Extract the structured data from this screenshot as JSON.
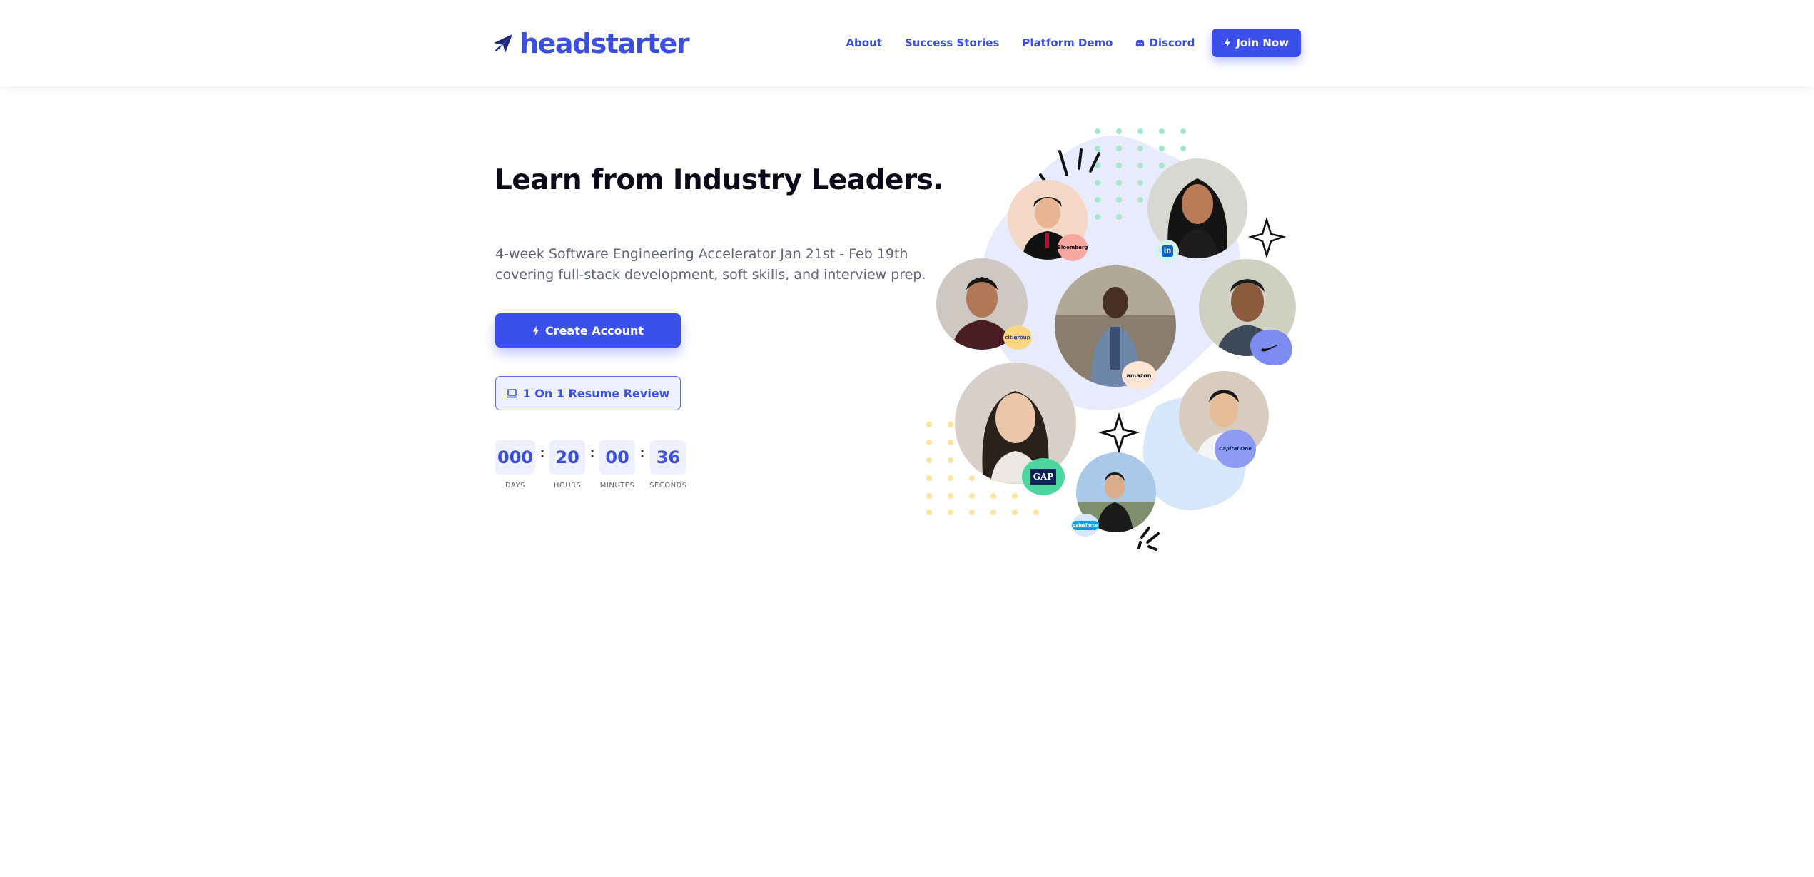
{
  "brand": {
    "name": "headstarter",
    "accent": "#3b4fea"
  },
  "nav": {
    "links": [
      {
        "label": "About"
      },
      {
        "label": "Success Stories"
      },
      {
        "label": "Platform Demo"
      },
      {
        "label": "Discord",
        "icon": "discord-icon"
      }
    ],
    "join_label": "Join Now"
  },
  "hero": {
    "title": "Learn from Industry Leaders.",
    "subtitle": "4-week Software Engineering Accelerator Jan 21st - Feb 19th covering full-stack development, soft skills, and interview prep.",
    "primary_button": "Create Account",
    "secondary_button": "1 On 1 Resume Review"
  },
  "countdown": {
    "days": "000",
    "days_label": "DAYS",
    "hours": "20",
    "hours_label": "HOURS",
    "minutes": "00",
    "minutes_label": "MINUTES",
    "seconds": "36",
    "seconds_label": "SECONDS",
    "separator": ":"
  },
  "collage": {
    "badges": {
      "bloomberg": "Bloomberg",
      "citigroup": "citigroup",
      "amazon": "amazon",
      "gap": "GAP",
      "capitalone": "Capital One",
      "salesforce": "salesforce"
    },
    "colors": {
      "blob": "#e8eafd",
      "dots_green": "#a8e6c9",
      "dots_yellow": "#fde3a0",
      "light_blue": "#d6e6fb"
    }
  }
}
